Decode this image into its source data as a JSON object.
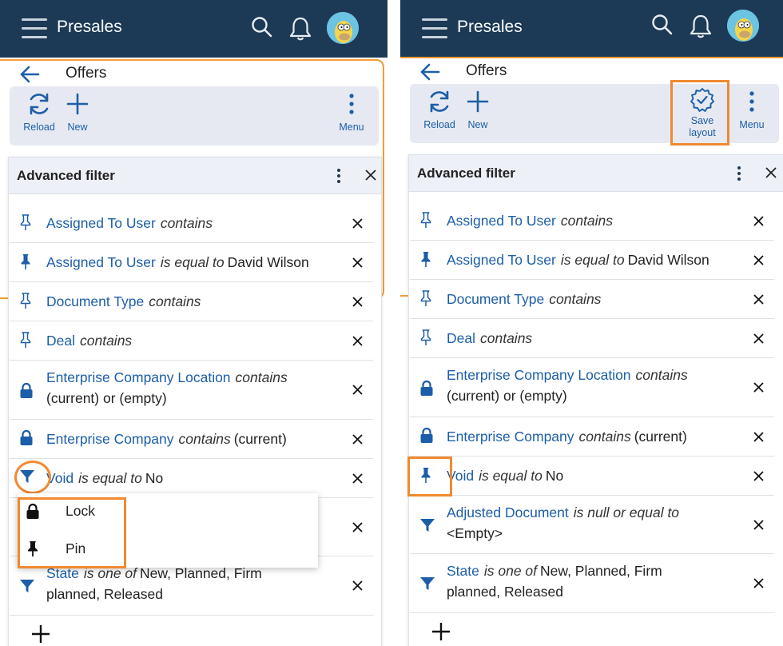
{
  "app": {
    "title": "Presales"
  },
  "page": {
    "title": "Offers"
  },
  "toolbar": {
    "reload_label": "Reload",
    "new_label": "New",
    "save_layout_line1": "Save",
    "save_layout_line2": "layout",
    "menu_label": "Menu"
  },
  "filter": {
    "title": "Advanced filter",
    "left_rows": [
      {
        "field": "Assigned To User",
        "op": "contains",
        "value": "",
        "value2": "",
        "icon": "pin-outline-icon"
      },
      {
        "field": "Assigned To User",
        "op": "is equal to",
        "value": "David Wilson",
        "value2": "",
        "icon": "pin-solid-icon"
      },
      {
        "field": "Document Type",
        "op": "contains",
        "value": "",
        "value2": "",
        "icon": "pin-outline-icon"
      },
      {
        "field": "Deal",
        "op": "contains",
        "value": "",
        "value2": "",
        "icon": "pin-outline-icon"
      },
      {
        "field": "Enterprise Company Location",
        "op": "contains",
        "value": "",
        "value2": "(current) or (empty)",
        "icon": "lock-icon"
      },
      {
        "field": "Enterprise Company",
        "op": "contains",
        "value": "(current)",
        "value2": "",
        "icon": "lock-icon"
      },
      {
        "field": "Void",
        "op": "is equal to",
        "value": "No",
        "value2": "",
        "icon": "filter-icon"
      },
      {
        "field": "",
        "op": "",
        "value": "",
        "value2": "",
        "icon": "filter-icon"
      },
      {
        "field": "State",
        "op": "is one of",
        "value": "New, Planned, Firm",
        "value2": "planned, Released",
        "icon": "filter-icon"
      }
    ],
    "right_rows": [
      {
        "field": "Assigned To User",
        "op": "contains",
        "value": "",
        "value2": "",
        "icon": "pin-outline-icon"
      },
      {
        "field": "Assigned To User",
        "op": "is equal to",
        "value": "David Wilson",
        "value2": "",
        "icon": "pin-solid-icon"
      },
      {
        "field": "Document Type",
        "op": "contains",
        "value": "",
        "value2": "",
        "icon": "pin-outline-icon"
      },
      {
        "field": "Deal",
        "op": "contains",
        "value": "",
        "value2": "",
        "icon": "pin-outline-icon"
      },
      {
        "field": "Enterprise Company Location",
        "op": "contains",
        "value": "",
        "value2": "(current) or (empty)",
        "icon": "lock-icon"
      },
      {
        "field": "Enterprise Company",
        "op": "contains",
        "value": "(current)",
        "value2": "",
        "icon": "lock-icon"
      },
      {
        "field": "Void",
        "op": "is equal to",
        "value": "No",
        "value2": "",
        "icon": "pin-solid-icon"
      },
      {
        "field": "Adjusted Document",
        "op": "is null or equal to",
        "value": "",
        "value2": "<Empty>",
        "icon": "filter-icon"
      },
      {
        "field": "State",
        "op": "is one of",
        "value": "New, Planned, Firm",
        "value2": "planned, Released",
        "icon": "filter-icon"
      }
    ]
  },
  "popup": {
    "lock_label": "Lock",
    "pin_label": "Pin"
  },
  "colors": {
    "appbar": "#1c3a56",
    "accent": "#1c5ea8",
    "highlight": "#f08a32"
  }
}
